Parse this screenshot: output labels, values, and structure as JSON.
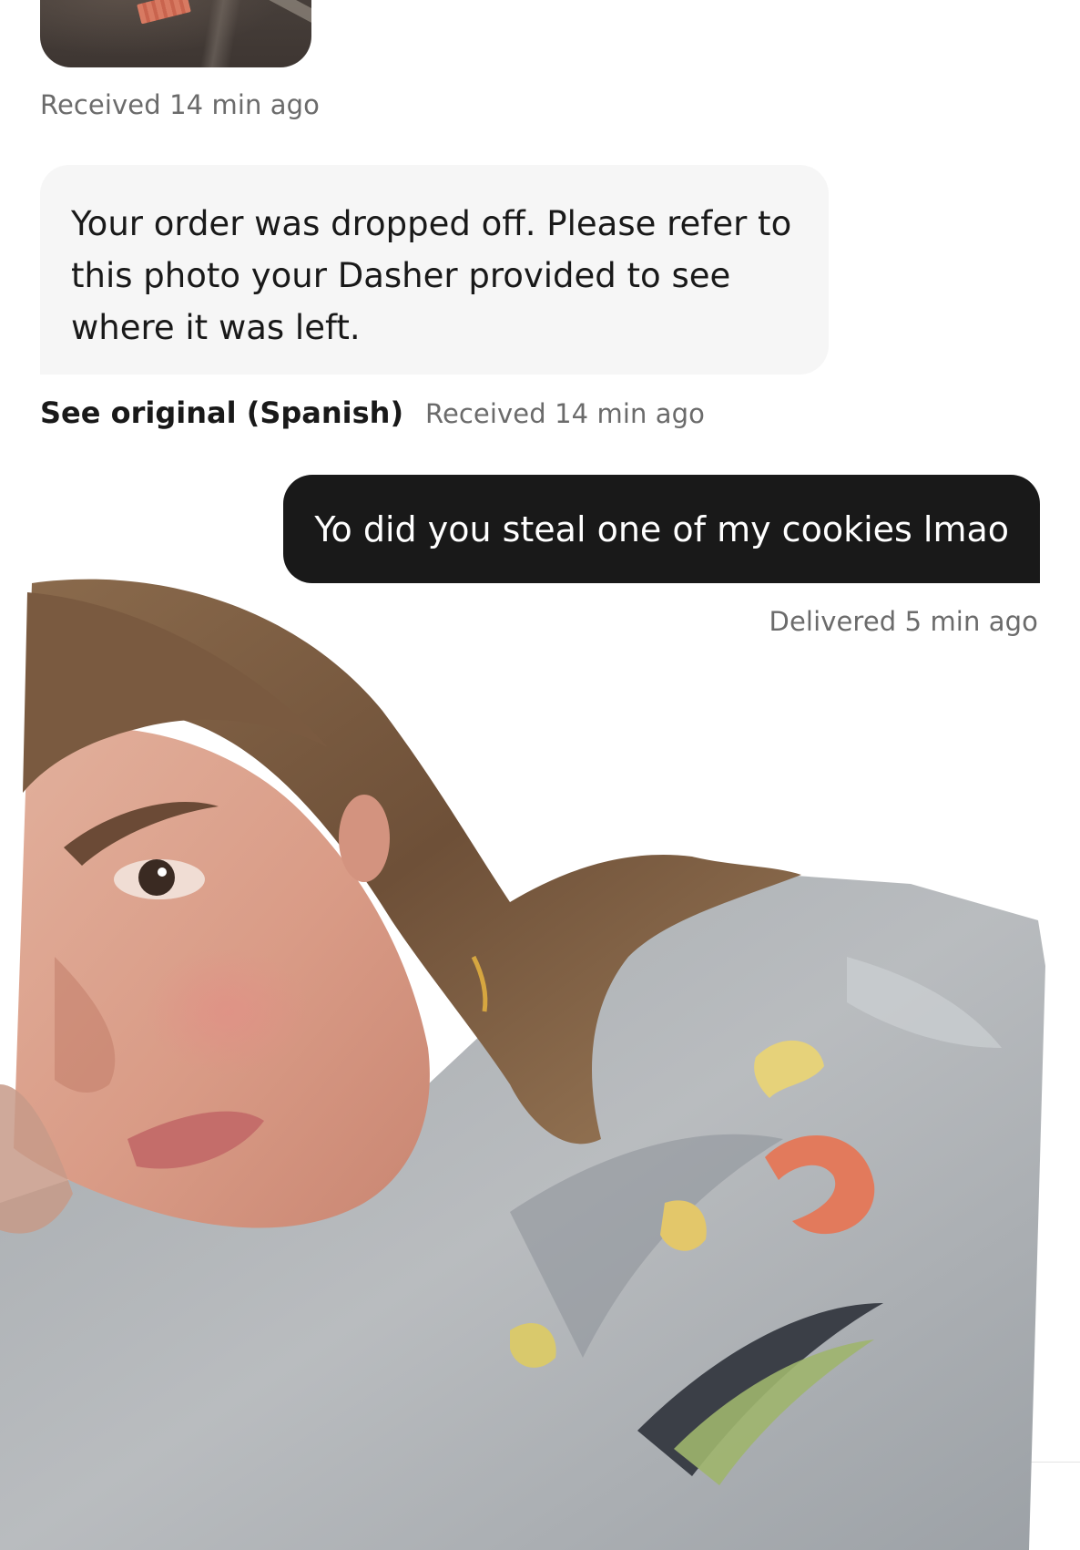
{
  "messages": [
    {
      "type": "photo",
      "direction": "received",
      "icon": "photo-thumbnail",
      "status": "Received 14 min ago"
    },
    {
      "type": "text",
      "direction": "received",
      "text": "Your order was dropped off. Please refer to this photo your Dasher provided to see where it was left.",
      "translation_link": "See original (Spanish)",
      "status": "Received 14 min ago"
    },
    {
      "type": "text",
      "direction": "sent",
      "text": "Yo did you steal one of my cookies lmao",
      "status": "Delivered 5 min ago"
    }
  ],
  "colors": {
    "received_bubble": "#f6f6f6",
    "sent_bubble": "#191919",
    "meta_text": "#6b6b6b",
    "primary_text": "#191919"
  }
}
